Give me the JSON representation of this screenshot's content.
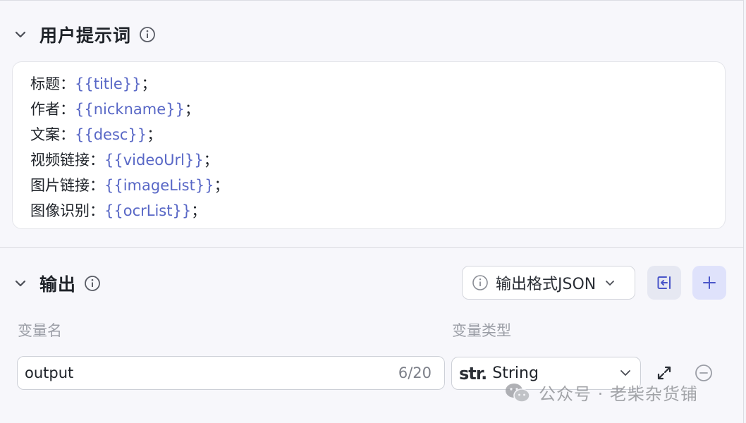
{
  "prompt_section": {
    "title": "用户提示词",
    "lines": [
      {
        "label": "标题：",
        "var": "{{title}}",
        "suffix": "；"
      },
      {
        "label": "作者：",
        "var": "{{nickname}}",
        "suffix": "；"
      },
      {
        "label": "文案：",
        "var": "{{desc}}",
        "suffix": "；"
      },
      {
        "label": "视频链接：",
        "var": "{{videoUrl}}",
        "suffix": "；"
      },
      {
        "label": "图片链接：",
        "var": "{{imageList}}",
        "suffix": "；"
      },
      {
        "label": "图像识别：",
        "var": "{{ocrList}}",
        "suffix": "；"
      }
    ]
  },
  "output_section": {
    "title": "输出",
    "format_select": "输出格式JSON",
    "col_name_label": "变量名",
    "col_type_label": "变量类型",
    "row": {
      "name_value": "output",
      "char_count": "6/20",
      "type_tag": "str.",
      "type_label": "String"
    }
  },
  "watermark": {
    "text": "公众号 · 老柴杂货铺"
  },
  "colors": {
    "variable": "#5867c6",
    "accent": "#4a56c9",
    "muted": "#9b9ea6"
  },
  "icons": [
    "chevron-down-icon",
    "info-icon",
    "import-icon",
    "plus-icon",
    "expand-icon",
    "remove-icon",
    "wechat-icon"
  ]
}
